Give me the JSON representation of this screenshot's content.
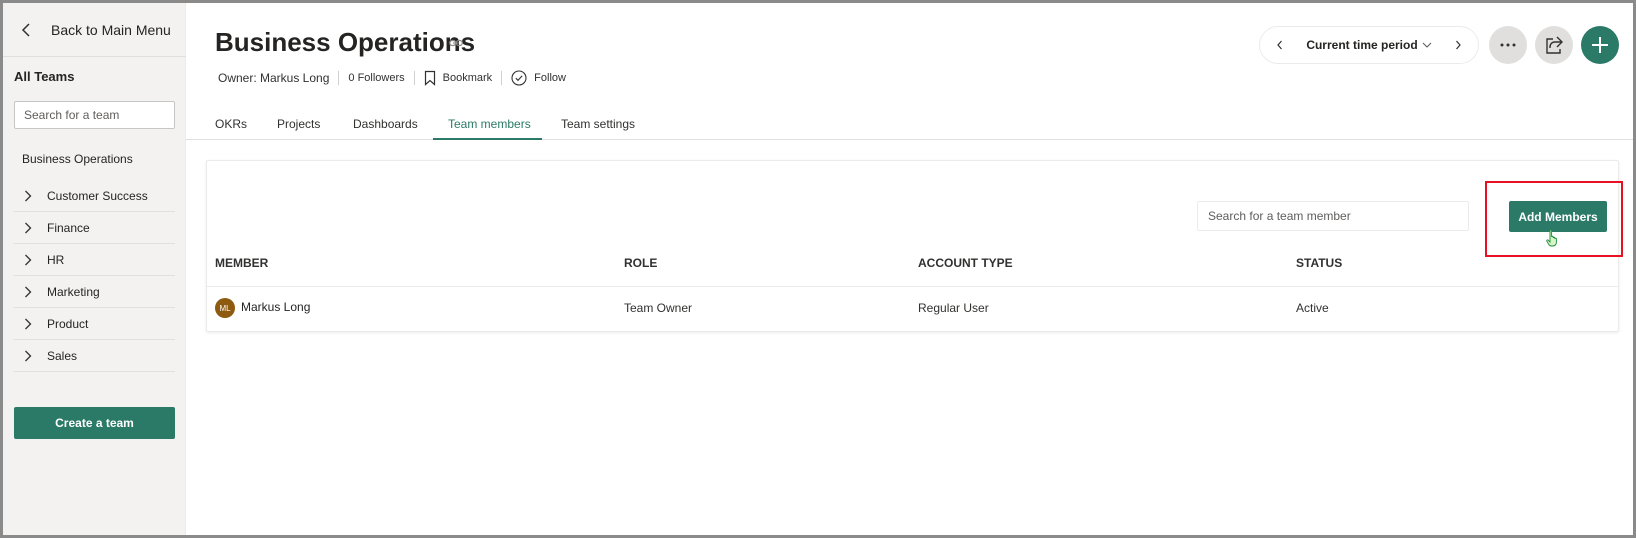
{
  "sidebar": {
    "back_label": "Back to Main Menu",
    "all_teams_label": "All Teams",
    "search_placeholder": "Search for a team",
    "current_team": "Business Operations",
    "teams": [
      {
        "label": "Customer Success"
      },
      {
        "label": "Finance"
      },
      {
        "label": "HR"
      },
      {
        "label": "Marketing"
      },
      {
        "label": "Product"
      },
      {
        "label": "Sales"
      }
    ],
    "create_team_label": "Create a team"
  },
  "header": {
    "title": "Business Operations",
    "owner": "Owner: Markus Long",
    "followers": "0 Followers",
    "bookmark_label": "Bookmark",
    "follow_label": "Follow",
    "time_period_label": "Current time period"
  },
  "tabs": [
    {
      "label": "OKRs",
      "active": false
    },
    {
      "label": "Projects",
      "active": false
    },
    {
      "label": "Dashboards",
      "active": false
    },
    {
      "label": "Team members",
      "active": true
    },
    {
      "label": "Team settings",
      "active": false
    }
  ],
  "members": {
    "search_placeholder": "Search for a team member",
    "add_button_label": "Add Members",
    "columns": [
      "MEMBER",
      "ROLE",
      "ACCOUNT TYPE",
      "STATUS"
    ],
    "rows": [
      {
        "initials": "ML",
        "name": "Markus Long",
        "role": "Team Owner",
        "account_type": "Regular User",
        "status": "Active"
      }
    ]
  },
  "colors": {
    "accent": "#2b7a68",
    "highlight": "#e81123",
    "avatar": "#8e5a0f"
  },
  "icons": {
    "back": "chevron-left-icon",
    "expand": "chevron-right-icon",
    "link": "link-icon",
    "bookmark": "bookmark-icon",
    "follow": "check-circle-icon",
    "more": "ellipsis-icon",
    "share": "share-icon",
    "add": "plus-icon"
  }
}
